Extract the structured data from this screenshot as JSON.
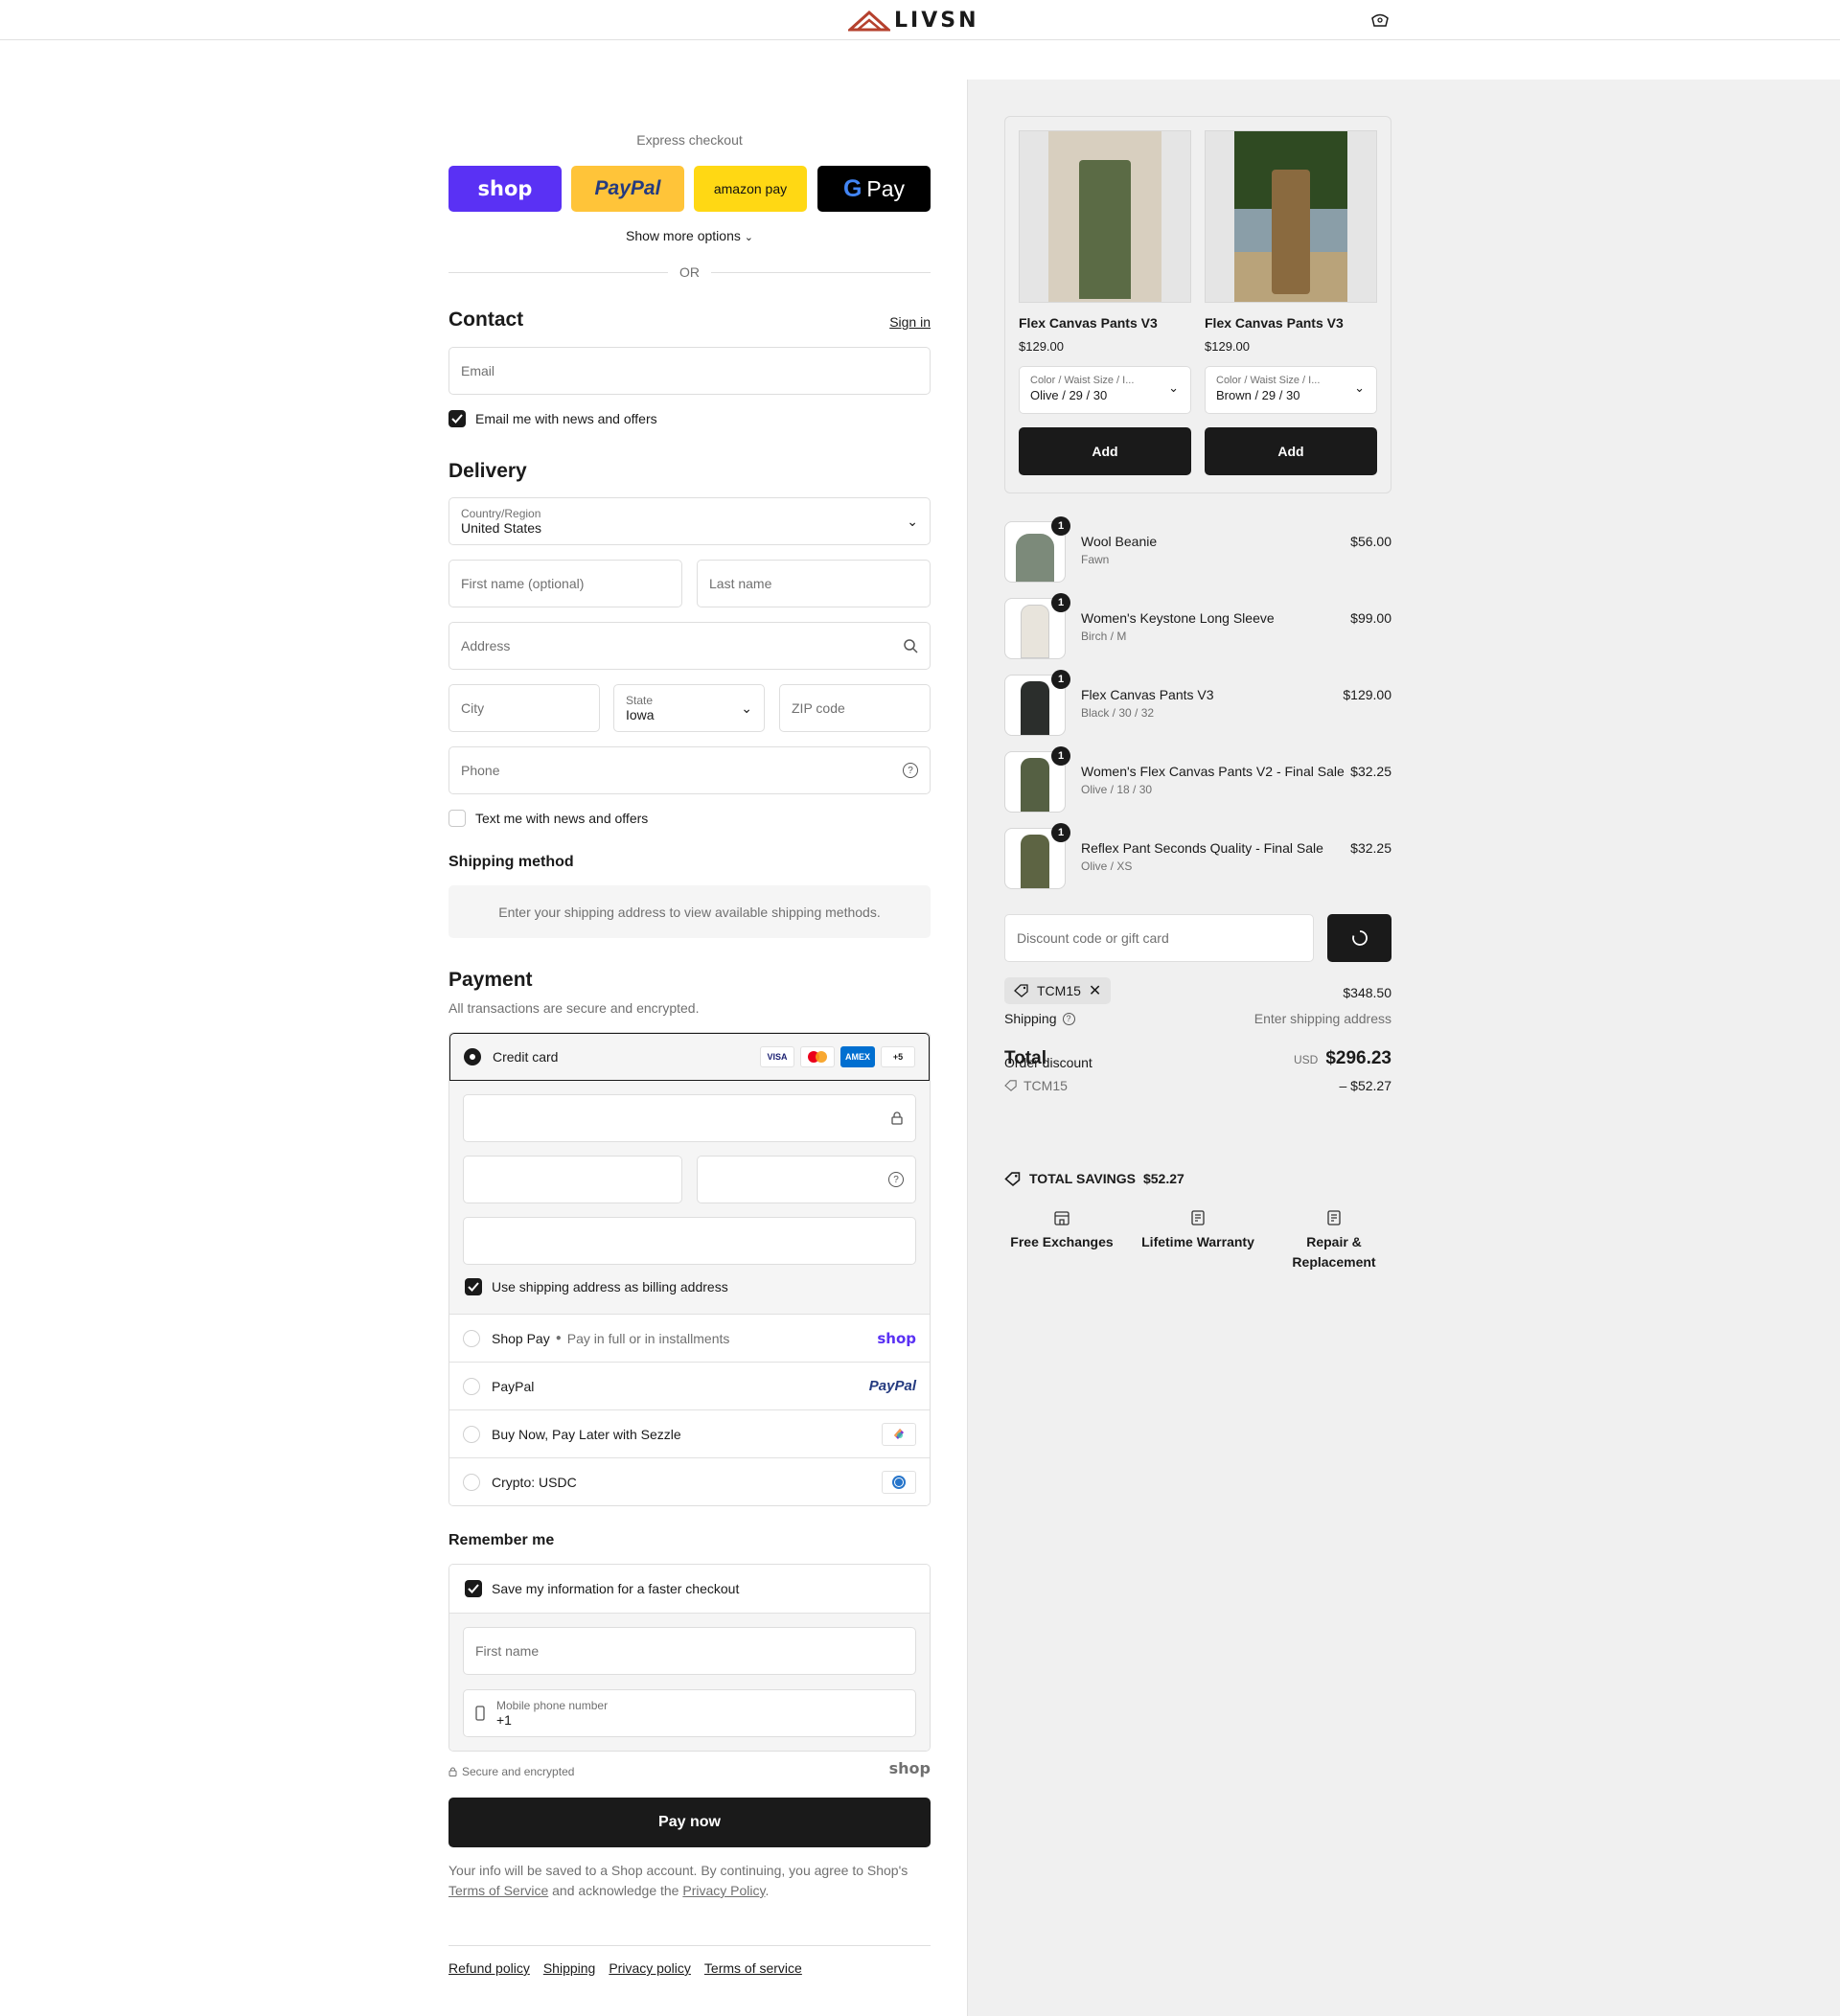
{
  "header": {
    "logo_text": "LIVSN",
    "logo_icon": "mountain-logo-icon",
    "cart_icon": "bag-icon"
  },
  "express": {
    "title": "Express checkout",
    "buttons": [
      {
        "label": "shop",
        "color": "#5a31f4",
        "text_color": "#ffffff"
      },
      {
        "label": "PayPal",
        "color": "#ffc439",
        "text_color": "#253b80"
      },
      {
        "label": "amazon pay",
        "color": "#ffd814",
        "text_color": "#111111"
      },
      {
        "label": "Pay",
        "color": "#000000",
        "text_color": "#ffffff"
      }
    ],
    "show_more": "Show more options",
    "or": "OR"
  },
  "contact": {
    "title": "Contact",
    "sign_in": "Sign in",
    "email_placeholder": "Email",
    "news_label": "Email me with news and offers",
    "news_checked": true
  },
  "delivery": {
    "title": "Delivery",
    "country_label": "Country/Region",
    "country_value": "United States",
    "first_name_placeholder": "First name (optional)",
    "last_name_placeholder": "Last name",
    "address_placeholder": "Address",
    "city_placeholder": "City",
    "state_label": "State",
    "state_value": "Iowa",
    "zip_placeholder": "ZIP code",
    "phone_placeholder": "Phone",
    "sms_label": "Text me with news and offers",
    "sms_checked": false
  },
  "shipping_method": {
    "title": "Shipping method",
    "note": "Enter your shipping address to view available shipping methods."
  },
  "payment": {
    "title": "Payment",
    "subtitle": "All transactions are secure and encrypted.",
    "credit_card_label": "Credit card",
    "card_badges": [
      "VISA",
      "MC",
      "AMEX",
      "+5"
    ],
    "billing_label": "Use shipping address as billing address",
    "billing_checked": true,
    "options": [
      {
        "label": "Shop Pay",
        "sub": "Pay in full or in installments",
        "brand": "shop"
      },
      {
        "label": "PayPal",
        "sub": "",
        "brand": "PayPal"
      },
      {
        "label": "Buy Now, Pay Later with Sezzle",
        "sub": "",
        "brand": "sezzle-icon"
      },
      {
        "label": "Crypto: USDC",
        "sub": "",
        "brand": "usdc-icon"
      }
    ]
  },
  "remember": {
    "title": "Remember me",
    "save_label": "Save my information for a faster checkout",
    "save_checked": true,
    "first_name_placeholder": "First name",
    "mobile_label": "Mobile phone number",
    "mobile_value": "+1",
    "secure_text": "Secure and encrypted",
    "shop_brand": "shop"
  },
  "pay_now": "Pay now",
  "legal": {
    "text1": "Your info will be saved to a Shop account. By continuing, you agree to Shop's",
    "terms": "Terms of Service",
    "text2": "and acknowledge the",
    "privacy": "Privacy Policy",
    "end": "."
  },
  "footer_links": [
    "Refund policy",
    "Shipping",
    "Privacy policy",
    "Terms of service"
  ],
  "recommendations": [
    {
      "name": "Flex Canvas Pants V3",
      "price": "$129.00",
      "variant_label": "Color / Waist Size / I...",
      "variant_value": "Olive / 29 / 30",
      "add": "Add",
      "color": "#5b6b45"
    },
    {
      "name": "Flex Canvas Pants V3",
      "price": "$129.00",
      "variant_label": "Color / Waist Size / I...",
      "variant_value": "Brown / 29 / 30",
      "add": "Add",
      "color": "#8a6a3f"
    }
  ],
  "items": [
    {
      "name": "Wool Beanie",
      "variant": "Fawn",
      "price": "$56.00",
      "qty": "1",
      "color": "#7c8a7a"
    },
    {
      "name": "Women's Keystone Long Sleeve",
      "variant": "Birch / M",
      "price": "$99.00",
      "qty": "1",
      "color": "#e8e4dc"
    },
    {
      "name": "Flex Canvas Pants V3",
      "variant": "Black / 30 / 32",
      "price": "$129.00",
      "qty": "1",
      "color": "#2b2e2c"
    },
    {
      "name": "Women's Flex Canvas Pants V2 - Final Sale",
      "variant": "Olive / 18 / 30",
      "price": "$32.25",
      "qty": "1",
      "color": "#556043"
    },
    {
      "name": "Reflex Pant Seconds Quality - Final Sale",
      "variant": "Olive / XS",
      "price": "$32.25",
      "qty": "1",
      "color": "#5d6443"
    }
  ],
  "discount": {
    "placeholder": "Discount code or gift card",
    "applied_code": "TCM15"
  },
  "summary": {
    "subtotal": "$348.50",
    "shipping_label": "Shipping",
    "shipping_value": "Enter shipping address",
    "order_discount_label": "Order discount",
    "total_label": "Total",
    "currency": "USD",
    "total": "$296.23",
    "discount_code": "TCM15",
    "discount_value": "– $52.27"
  },
  "savings": {
    "label": "TOTAL SAVINGS",
    "value": "$52.27"
  },
  "perks": [
    {
      "label": "Free Exchanges",
      "icon": "store-icon"
    },
    {
      "label": "Lifetime Warranty",
      "icon": "document-icon"
    },
    {
      "label": "Repair & Replacement",
      "icon": "document-icon"
    }
  ]
}
